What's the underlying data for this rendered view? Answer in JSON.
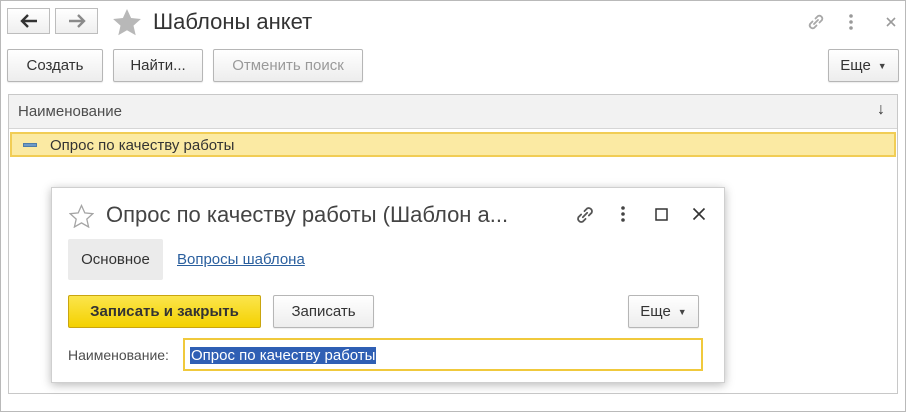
{
  "main_window": {
    "title": "Шаблоны анкет",
    "nav": {
      "back_icon": "arrow-left-icon",
      "forward_icon": "arrow-right-icon"
    },
    "toolbar": {
      "create_label": "Создать",
      "find_label": "Найти...",
      "cancel_search_label": "Отменить поиск",
      "more_label": "Еще"
    },
    "list": {
      "column_header": "Наименование",
      "sort_icon": "↓",
      "rows": [
        {
          "name": "Опрос по качеству работы",
          "selected": true
        }
      ]
    }
  },
  "dialog": {
    "title": "Опрос по качеству работы (Шаблон а...",
    "tabs": [
      {
        "label": "Основное",
        "active": true
      },
      {
        "label": "Вопросы шаблона",
        "active": false
      }
    ],
    "buttons": {
      "save_close_label": "Записать и закрыть",
      "save_label": "Записать",
      "more_label": "Еще"
    },
    "field": {
      "label": "Наименование:",
      "value": "Опрос по качеству работы"
    }
  },
  "colors": {
    "accent_yellow": "#f4d100",
    "row_highlight": "#fbeaa3",
    "focus_border": "#f0c93c",
    "link": "#2a5f9e",
    "text_selection": "#2f5fb4"
  }
}
